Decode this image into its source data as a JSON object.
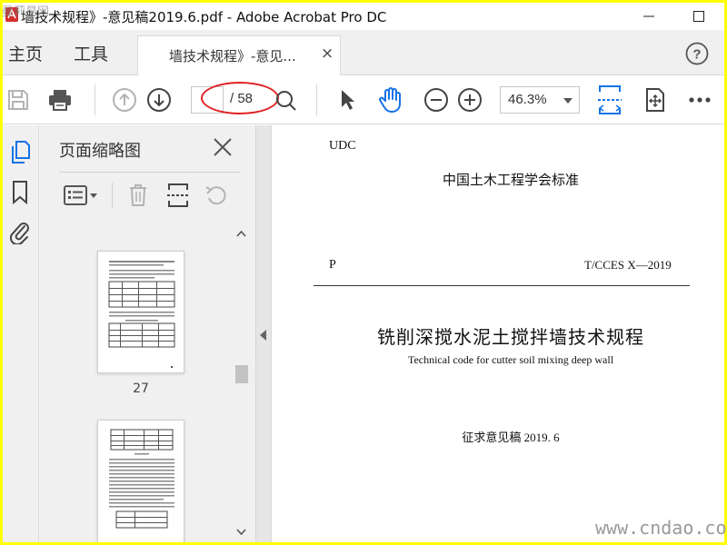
{
  "window": {
    "title": "墙技术规程》-意见稿2019.6.pdf - Adobe Acrobat Pro DC",
    "minimize_glyph": "—",
    "maximize_glyph": "☐"
  },
  "menu": {
    "home": "主页",
    "tools": "工具",
    "tab_label": "墙技术规程》-意见...",
    "tab_close": "×"
  },
  "toolbar": {
    "current_page": "",
    "total_pages": "/ 58",
    "zoom": "46.3%"
  },
  "thumbnail_panel": {
    "title": "页面缩略图",
    "thumbnails": [
      {
        "page_label": "27"
      },
      {
        "page_label": ""
      }
    ]
  },
  "document": {
    "udc": "UDC",
    "association": "中国土木工程学会标准",
    "p": "P",
    "code": "T/CCES X—2019",
    "title_cn": "铣削深搅水泥土搅拌墙技术规程",
    "title_en": "Technical code for cutter soil mixing deep wall",
    "draft": "征求意见稿 2019. 6"
  },
  "watermarks": {
    "bottom_right": "www.cndao.com",
    "top_left": "曼莉易网"
  },
  "colors": {
    "accent_blue": "#1473e6",
    "annotation_red": "#e02020",
    "frame_yellow": "#ffff00",
    "chrome_gray": "#f0f0f0"
  },
  "icons": {
    "app": "acrobat-icon",
    "save": "save-icon",
    "print": "print-icon",
    "prev": "arrow-up-icon",
    "next": "arrow-down-icon",
    "select": "cursor-icon",
    "hand": "hand-icon",
    "zoom_out": "zoom-out-icon",
    "zoom_in": "zoom-in-icon",
    "help": "help-icon"
  }
}
